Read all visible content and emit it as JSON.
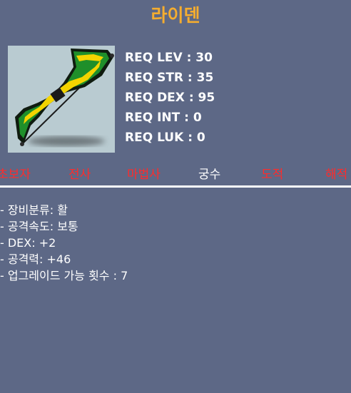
{
  "item": {
    "name": "라이덴",
    "icon": "bow-icon"
  },
  "requirements": [
    "REQ LEV : 30",
    "REQ STR : 35",
    "REQ DEX : 95",
    "REQ INT : 0",
    "REQ LUK : 0"
  ],
  "jobs": [
    {
      "label": "초보자",
      "color": "#ff2b2b"
    },
    {
      "label": "전사",
      "color": "#ff2b2b"
    },
    {
      "label": "마법사",
      "color": "#ff2b2b"
    },
    {
      "label": "궁수",
      "color": "#ffffff"
    },
    {
      "label": "도적",
      "color": "#ff2b2b"
    },
    {
      "label": "해적",
      "color": "#ff2b2b"
    }
  ],
  "properties": [
    "- 장비분류: 활",
    "- 공격속도: 보통",
    "- DEX: +2",
    "- 공격력: +46",
    "- 업그레이드 가능 횟수 : 7"
  ],
  "colors": {
    "title": "#f5ad2f",
    "background": "#5d6886",
    "icon_background": "#b9cbd1",
    "restricted_job": "#ff2b2b",
    "available_job": "#ffffff"
  }
}
